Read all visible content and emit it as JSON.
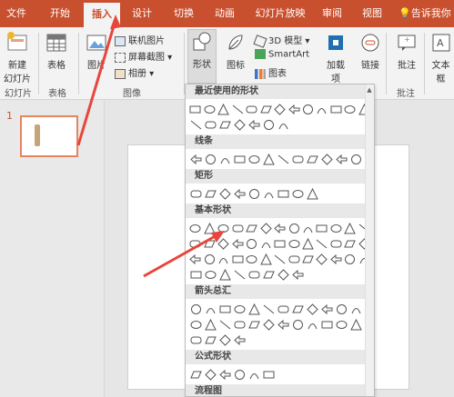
{
  "tabs": [
    {
      "label": "文件",
      "active": false
    },
    {
      "label": "开始",
      "active": false
    },
    {
      "label": "插入",
      "active": true
    },
    {
      "label": "设计",
      "active": false
    },
    {
      "label": "切换",
      "active": false
    },
    {
      "label": "动画",
      "active": false
    },
    {
      "label": "幻灯片放映",
      "active": false
    },
    {
      "label": "审阅",
      "active": false
    },
    {
      "label": "视图",
      "active": false
    }
  ],
  "tell_me": "告诉我你",
  "ribbon": {
    "new_slide": "新建\n幻灯片",
    "new_slide_label": "新建",
    "new_slide_label2": "幻灯片",
    "table": "表格",
    "picture": "图片",
    "online_picture": "联机图片",
    "screenshot": "屏幕截图",
    "album": "相册",
    "shapes": "形状",
    "icons": "图标",
    "model3d": "3D 模型",
    "smartart": "SmartArt",
    "chart": "图表",
    "addin": "加载",
    "addin2": "项",
    "link": "链接",
    "comment": "批注",
    "textbox": "文本框",
    "group_slides": "幻灯片",
    "group_table": "表格",
    "group_image": "图像",
    "group_comment": "批注"
  },
  "slides": {
    "number": "1"
  },
  "shape_panel": {
    "sections": [
      {
        "title": "最近使用的形状",
        "rows": [
          13,
          7
        ]
      },
      {
        "title": "线条",
        "rows": [
          12
        ]
      },
      {
        "title": "矩形",
        "rows": [
          9
        ]
      },
      {
        "title": "基本形状",
        "rows": [
          13,
          13,
          13,
          8
        ]
      },
      {
        "title": "箭头总汇",
        "rows": [
          12,
          12,
          4
        ]
      },
      {
        "title": "公式形状",
        "rows": [
          6
        ]
      },
      {
        "title": "流程图",
        "rows": []
      }
    ]
  },
  "colors": {
    "accent": "#c9502e",
    "annotation": "#e8453c"
  }
}
